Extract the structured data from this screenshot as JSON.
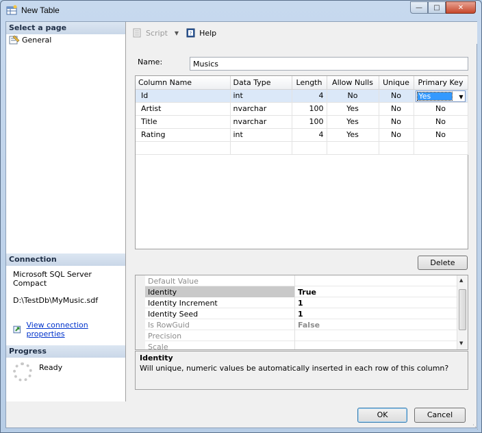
{
  "window": {
    "title": "New Table"
  },
  "left": {
    "select_header": "Select a page",
    "pages": [
      {
        "label": "General"
      }
    ],
    "connection_header": "Connection",
    "connection_server": "Microsoft SQL Server Compact",
    "connection_path": "D:\\TestDb\\MyMusic.sdf",
    "connection_link": "View connection properties",
    "progress_header": "Progress",
    "progress_status": "Ready"
  },
  "toolbar": {
    "script_label": "Script",
    "help_label": "Help"
  },
  "name_field": {
    "label": "Name:",
    "value": "Musics"
  },
  "grid": {
    "headers": [
      "Column Name",
      "Data Type",
      "Length",
      "Allow Nulls",
      "Unique",
      "Primary Key"
    ],
    "rows": [
      [
        "Id",
        "int",
        "4",
        "No",
        "No",
        "Yes"
      ],
      [
        "Artist",
        "nvarchar",
        "100",
        "Yes",
        "No",
        "No"
      ],
      [
        "Title",
        "nvarchar",
        "100",
        "Yes",
        "No",
        "No"
      ],
      [
        "Rating",
        "int",
        "4",
        "Yes",
        "No",
        "No"
      ]
    ]
  },
  "buttons": {
    "delete": "Delete",
    "ok": "OK",
    "cancel": "Cancel"
  },
  "properties": [
    {
      "name": "Default Value",
      "value": ""
    },
    {
      "name": "Identity",
      "value": "True"
    },
    {
      "name": "Identity Increment",
      "value": "1"
    },
    {
      "name": "Identity Seed",
      "value": "1"
    },
    {
      "name": "Is RowGuid",
      "value": "False"
    },
    {
      "name": "Precision",
      "value": ""
    },
    {
      "name": "Scale",
      "value": ""
    }
  ],
  "description": {
    "title": "Identity",
    "text": "Will unique, numeric values be automatically inserted in each row of this column?"
  }
}
